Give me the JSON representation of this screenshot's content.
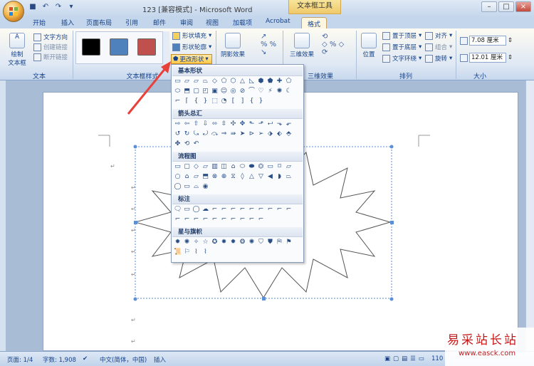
{
  "titlebar": {
    "doc_title": "123 [兼容模式] - Microsoft Word",
    "context_tool": "文本框工具"
  },
  "tabs": [
    "开始",
    "插入",
    "页面布局",
    "引用",
    "邮件",
    "审阅",
    "视图",
    "加载项",
    "Acrobat",
    "格式"
  ],
  "active_tab": "格式",
  "ribbon": {
    "text_group": {
      "label": "文本",
      "draw_textbox": "绘制\n文本框",
      "text_direction": "文字方向",
      "create_link": "创建链接",
      "break_link": "断开链接"
    },
    "textbox_styles": {
      "label": "文本框样式",
      "shape_fill": "形状填充",
      "shape_outline": "形状轮廓",
      "change_shape": "更改形状",
      "swatch_colors": [
        "#000000",
        "#4f81bd",
        "#c0504d"
      ]
    },
    "shadow_group": {
      "shadow_effect": "阴影效果"
    },
    "threed_group": {
      "label": "三维效果",
      "threed_effect": "三维效果"
    },
    "arrange_group": {
      "label": "排列",
      "position": "位置",
      "bring_front": "置于顶层",
      "send_back": "置于底层",
      "text_wrap": "文字环绕",
      "align": "对齐",
      "group": "组合",
      "rotate": "旋转"
    },
    "size_group": {
      "label": "大小",
      "height": "7.08 厘米",
      "width": "12.01 厘米"
    }
  },
  "dropdown": {
    "sections": [
      "基本形状",
      "箭头总汇",
      "流程图",
      "标注",
      "星与旗帜"
    ]
  },
  "status": {
    "page": "页面: 1/4",
    "words": "字数: 1,908",
    "language": "中文(简体，中国)",
    "mode": "插入",
    "zoom": "110"
  },
  "watermark": {
    "name": "易采站长站",
    "url": "www.easck.com"
  },
  "colors": {
    "accent_arrow": "#e8403b",
    "selection": "#5b8fd6"
  }
}
